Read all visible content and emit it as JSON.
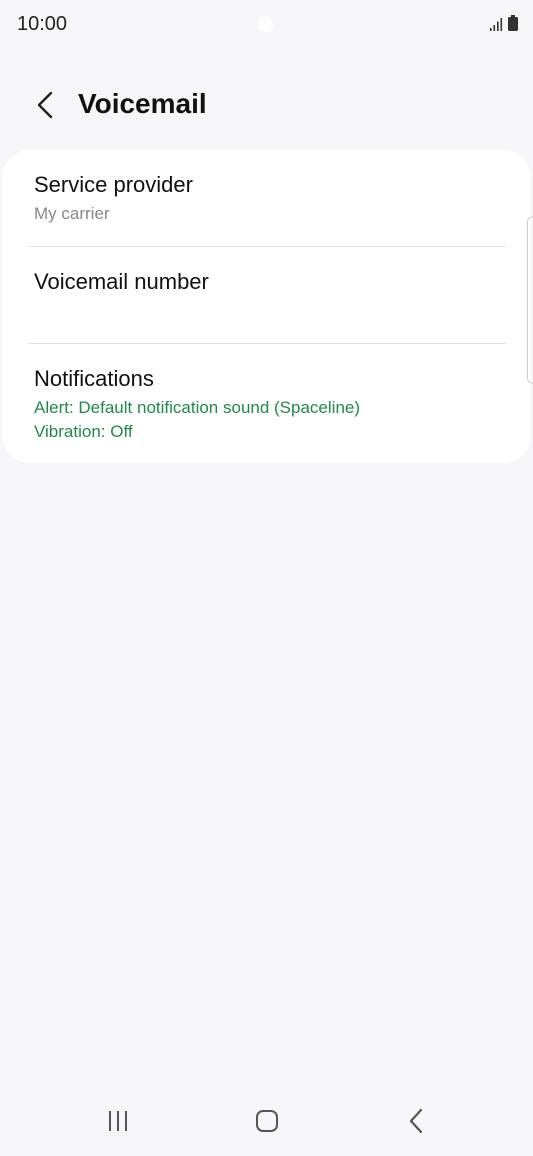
{
  "status_bar": {
    "time": "10:00"
  },
  "header": {
    "title": "Voicemail"
  },
  "settings": [
    {
      "title": "Service provider",
      "subtitle": "My carrier"
    },
    {
      "title": "Voicemail number",
      "subtitle": ""
    },
    {
      "title": "Notifications",
      "subtitle_line1": "Alert: Default notification sound (Spaceline)",
      "subtitle_line2": "Vibration: Off"
    }
  ],
  "colors": {
    "background": "#f6f6f8",
    "card": "#ffffff",
    "accent_green": "#1f8a4c",
    "secondary_text": "#888888"
  },
  "icons": {
    "back": "chevron-left-icon",
    "signal": "signal-icon",
    "battery": "battery-icon",
    "nav_recents": "recents-icon",
    "nav_home": "home-icon",
    "nav_back": "back-icon"
  }
}
